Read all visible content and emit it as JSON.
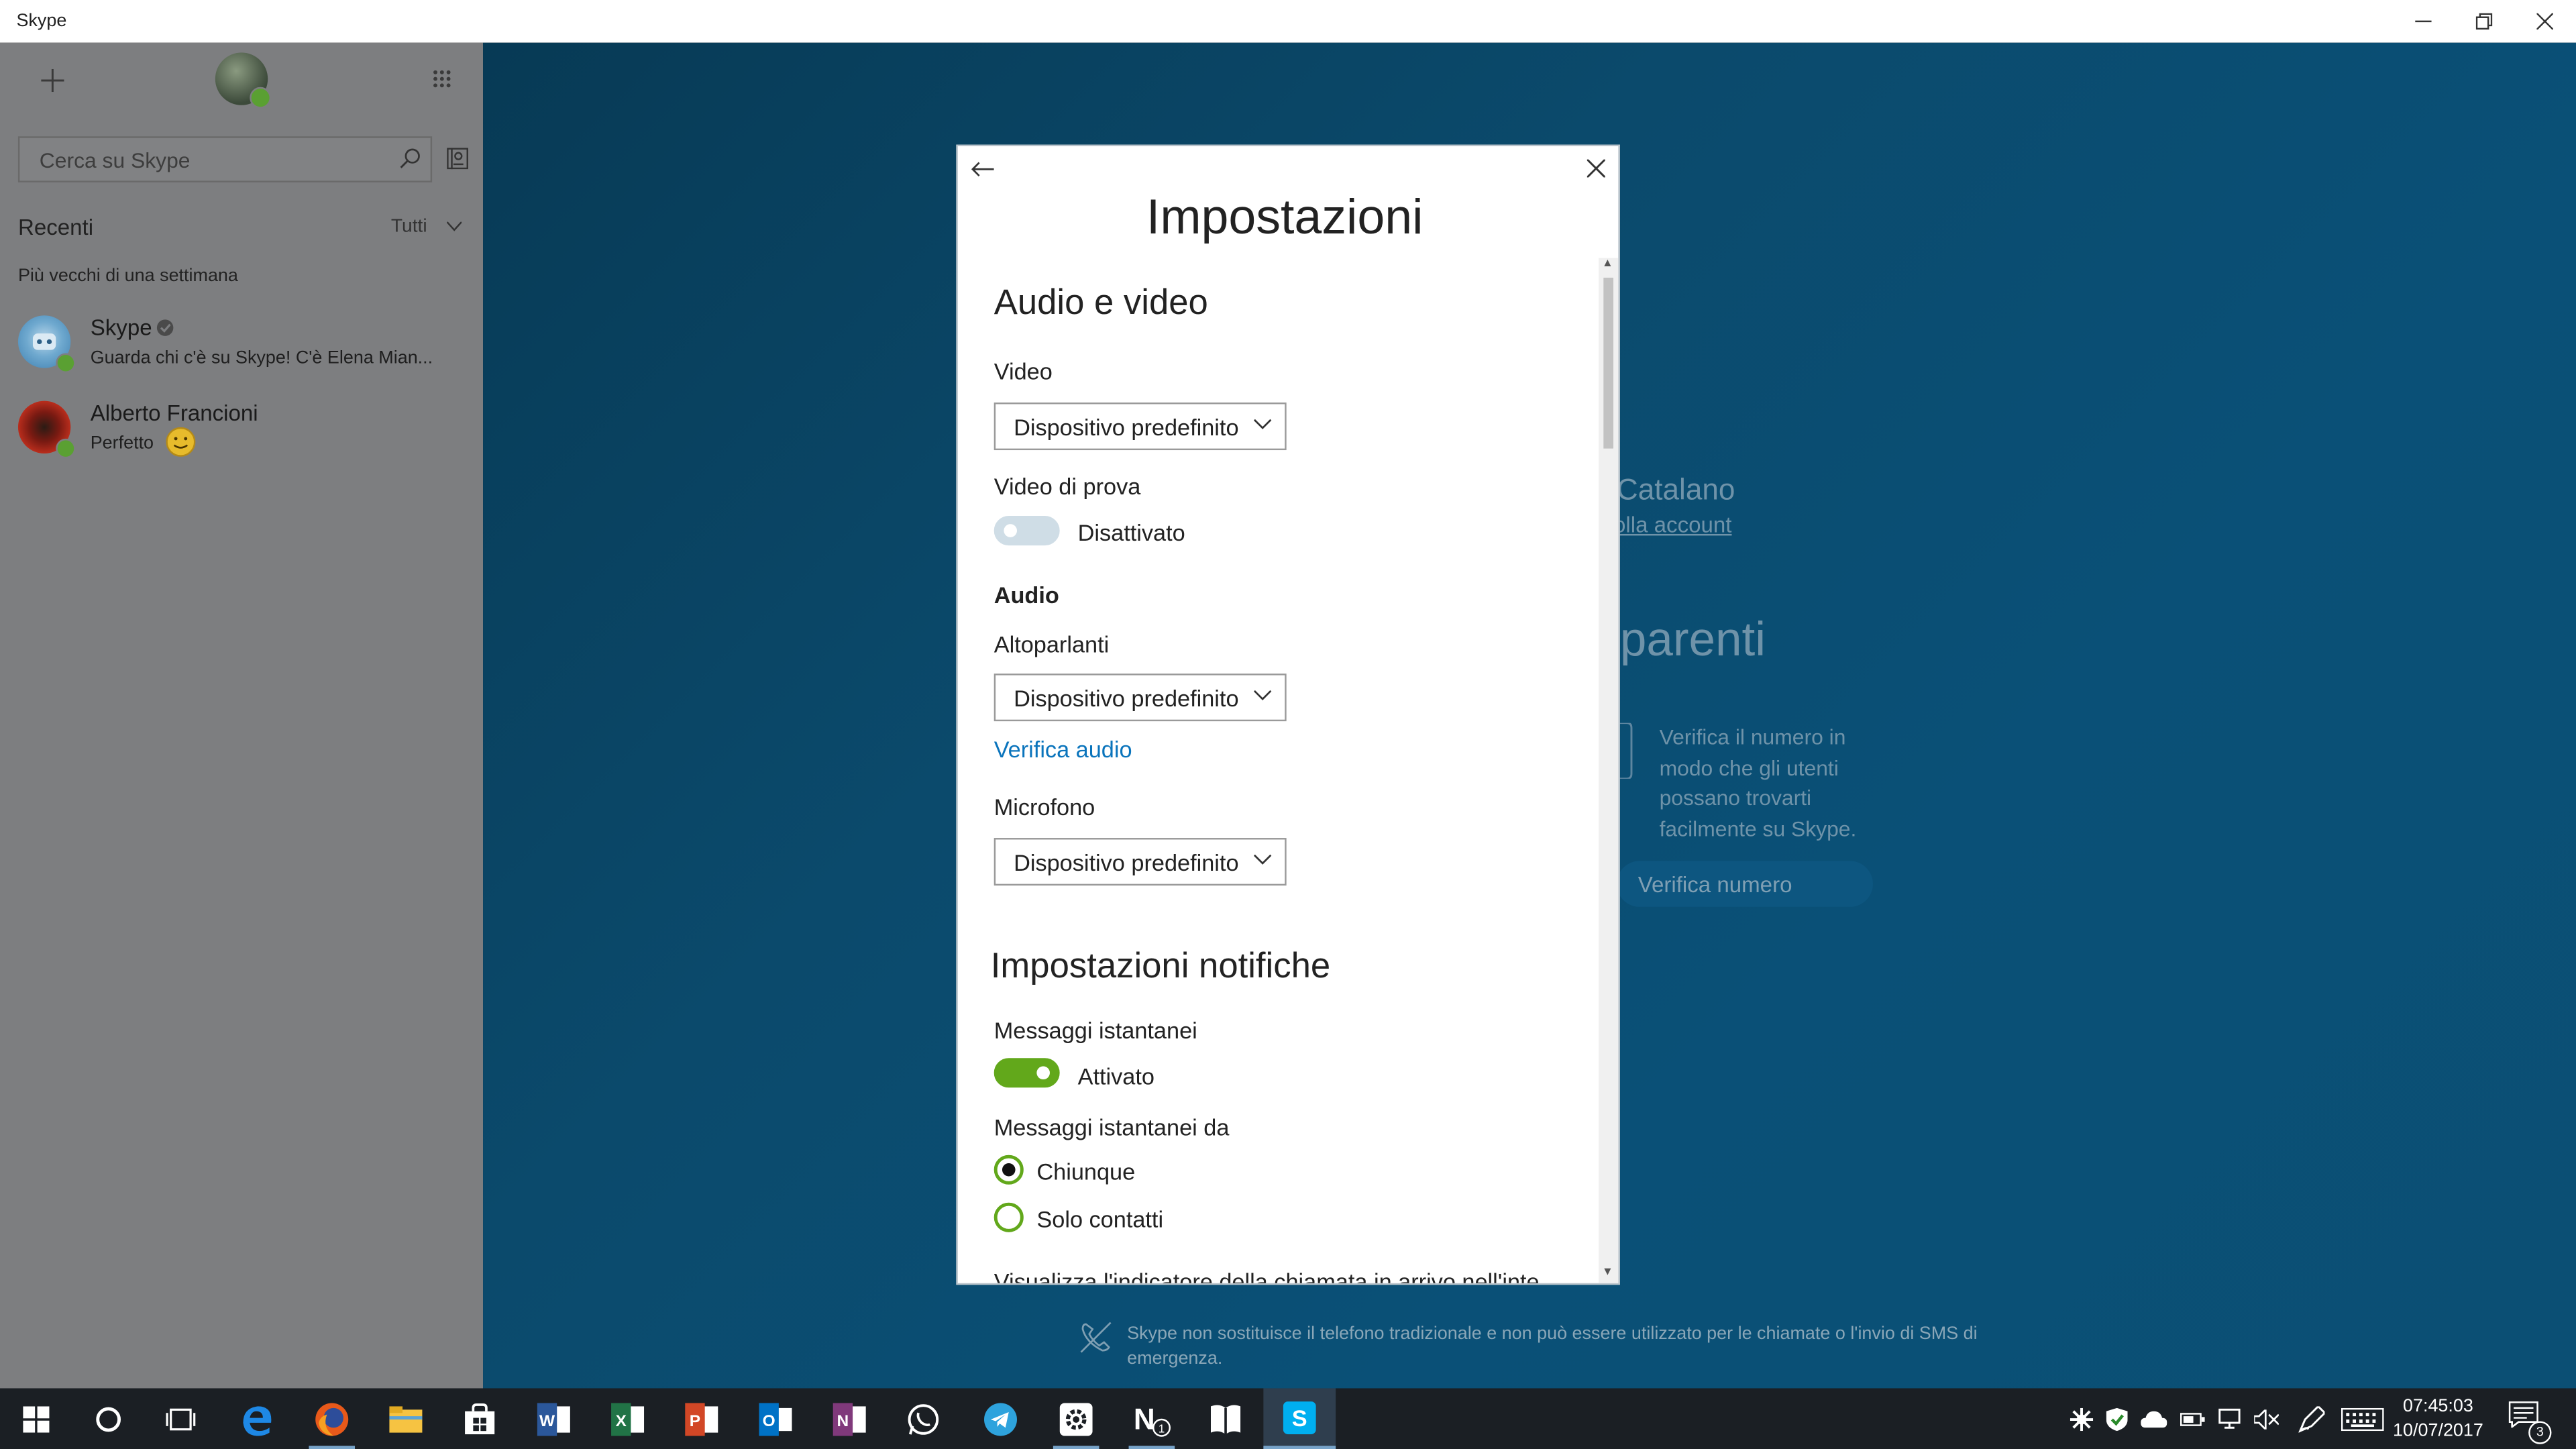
{
  "window": {
    "title": "Skype"
  },
  "sidebar": {
    "search_placeholder": "Cerca su Skype",
    "recent_title": "Recenti",
    "filter_label": "Tutti",
    "older_label": "Più vecchi di una settimana",
    "conversations": [
      {
        "name": "Skype",
        "preview": "Guarda chi c'è su Skype! C'è Elena Mian..."
      },
      {
        "name": "Alberto Francioni",
        "preview": "Perfetto"
      }
    ]
  },
  "background": {
    "name_fragment": "Catalano",
    "account_link_fragment": "olla account",
    "section_fragment": "parenti",
    "verify_info": "Verifica il numero in modo che gli utenti possano trovarti facilmente su Skype.",
    "verify_button": "Verifica numero"
  },
  "settings": {
    "title": "Impostazioni",
    "audio_video_heading": "Audio e video",
    "video_label": "Video",
    "video_device": "Dispositivo predefinito",
    "preview_label": "Video di prova",
    "preview_state": "Disattivato",
    "preview_on": false,
    "audio_heading": "Audio",
    "speakers_label": "Altoparlanti",
    "speakers_device": "Dispositivo predefinito",
    "verify_audio_link": "Verifica audio",
    "mic_label": "Microfono",
    "mic_device": "Dispositivo predefinito",
    "notifications_heading": "Impostazioni notifiche",
    "im_label": "Messaggi istantanei",
    "im_state": "Attivato",
    "im_on": true,
    "im_from_label": "Messaggi istantanei da",
    "im_from_options": [
      "Chiunque",
      "Solo contatti"
    ],
    "im_from_selected": "Chiunque",
    "partial_next_item": "Visualizza l'indicatore della chiamata in arrivo nell'inte"
  },
  "footer_notice": "Skype non sostituisce il telefono tradizionale e non può essere utilizzato per le chiamate o l'invio di SMS di emergenza.",
  "taskbar": {
    "time": "07:45:03",
    "date": "10/07/2017",
    "notification_count": "3",
    "apps": [
      "start",
      "cortana",
      "task-view",
      "edge",
      "firefox",
      "file-explorer",
      "store",
      "word",
      "excel",
      "powerpoint",
      "outlook",
      "onenote",
      "whatsapp",
      "telegram",
      "gear-app",
      "onenote-badge",
      "bookmark-app",
      "skype"
    ]
  },
  "colors": {
    "accent_green": "#62a81b",
    "link_blue": "#0a74bc",
    "background_blue": "#0b4a6c"
  }
}
